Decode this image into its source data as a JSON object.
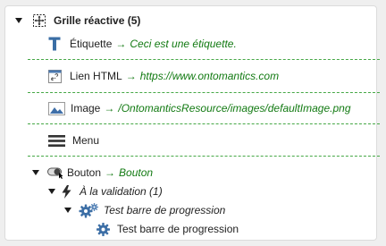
{
  "root": {
    "label": "Grille réactive (5)",
    "icon": "responsive-grid-icon"
  },
  "children": [
    {
      "label": "Étiquette",
      "arrow": "→",
      "value": "Ceci est une étiquette.",
      "icon": "text-t-icon"
    },
    {
      "label": "Lien HTML",
      "arrow": "→",
      "value": "https://www.ontomantics.com",
      "icon": "link-window-icon"
    },
    {
      "label": "Image",
      "arrow": "→",
      "value": "/OntomanticsResource/images/defaultImage.png",
      "icon": "image-icon"
    },
    {
      "label": "Menu",
      "icon": "menu-icon"
    }
  ],
  "button_node": {
    "label": "Bouton",
    "arrow": "→",
    "value": "Bouton",
    "icon": "toggle-button-icon",
    "event": {
      "label": "À la validation (1)",
      "icon": "lightning-icon",
      "action": {
        "label": "Test barre de progression",
        "icon": "gears-icon",
        "child": {
          "label": "Test barre de progression",
          "icon": "gear-icon"
        }
      }
    }
  },
  "colors": {
    "accent_green": "#127a12",
    "divider": "#46a846",
    "icon_blue": "#3a6ea5",
    "icon_dark": "#333333"
  }
}
